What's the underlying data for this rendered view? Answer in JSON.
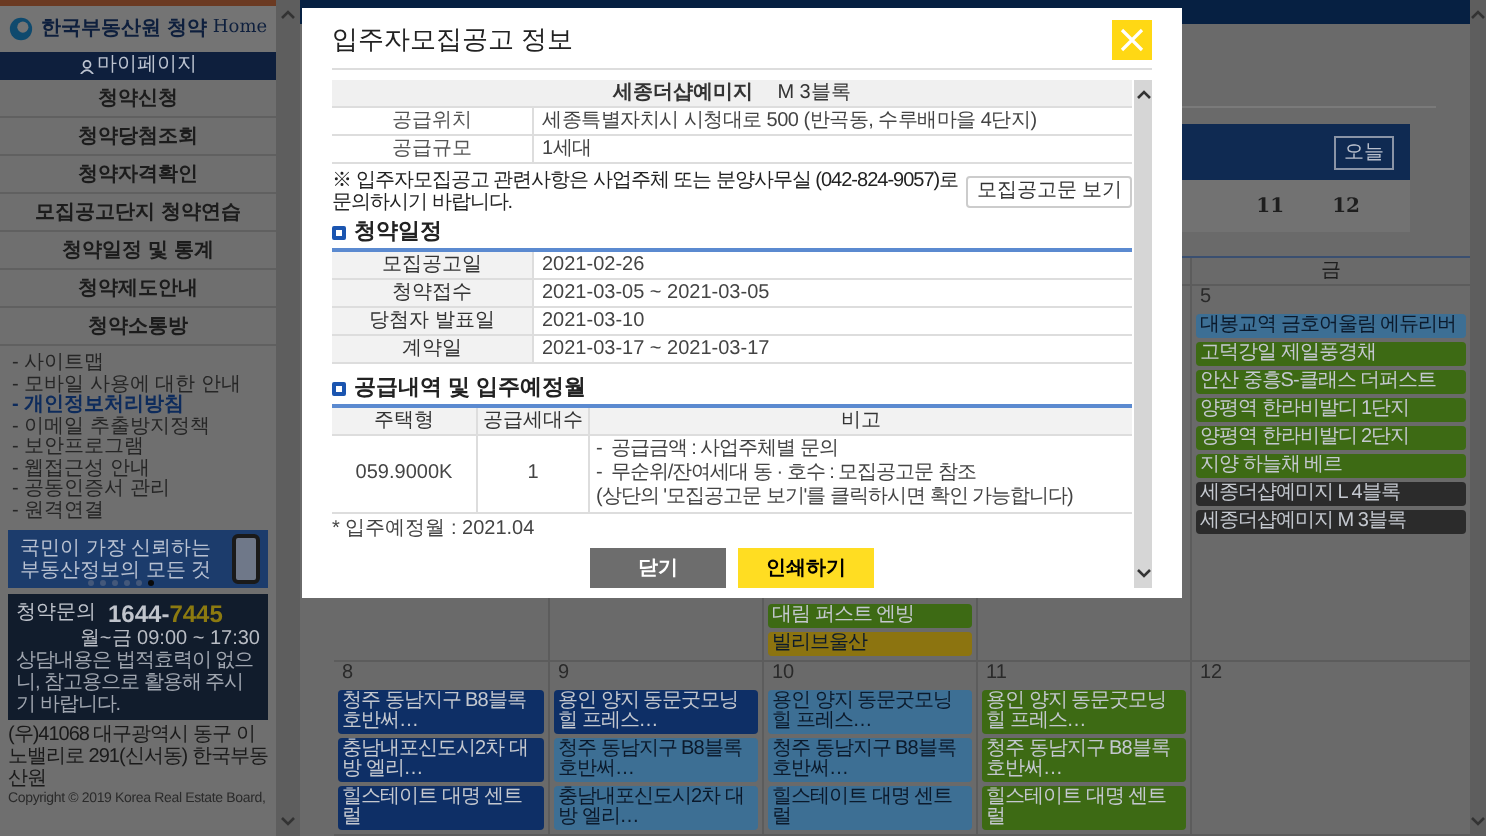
{
  "sidebar": {
    "brand": "한국부동산원",
    "service": "청약",
    "service_suffix": "Home",
    "mypage": "마이페이지",
    "menu": [
      "청약신청",
      "청약당첨조회",
      "청약자격확인",
      "모집공고단지 청약연습",
      "청약일정 및 통계",
      "청약제도안내",
      "청약소통방"
    ],
    "links": [
      {
        "label": "- 사이트맵",
        "highlighted": false
      },
      {
        "label": "- 모바일 사용에 대한 안내",
        "highlighted": false
      },
      {
        "label": "- 개인정보처리방침",
        "highlighted": true
      },
      {
        "label": "- 이메일 추출방지정책",
        "highlighted": false
      },
      {
        "label": "- 보안프로그램",
        "highlighted": false
      },
      {
        "label": "- 웹접근성 안내",
        "highlighted": false
      },
      {
        "label": "- 공동인증서 관리",
        "highlighted": false
      },
      {
        "label": "- 원격연결",
        "highlighted": false
      }
    ],
    "banner": {
      "lines": [
        "국민이 가장 신뢰하는",
        "부동산정보의 모든 것"
      ],
      "dots": [
        {
          "selected": false
        },
        {
          "selected": false
        },
        {
          "selected": false
        },
        {
          "selected": false
        },
        {
          "selected": false
        },
        {
          "selected": true
        }
      ]
    },
    "inquiry": {
      "label": "청약문의",
      "phone_prefix": "1644-",
      "phone_suffix": "7445",
      "hours": "월~금 09:00 ~ 17:30",
      "notice": "상담내용은 법적효력이 없으니, 참고용으로 활용해 주시기 바랍니다."
    },
    "address": "(우)41068 대구광역시 동구 이노밸리로 291(신서동) 한국부동산원",
    "copyright": "Copyright © 2019 Korea Real Estate Board,"
  },
  "calendar": {
    "today_button": "오늘",
    "strip_days": [
      "11",
      "12"
    ],
    "weekday_header": "금",
    "weeks": [
      {
        "cells": [
          {},
          {},
          {
            "events": [
              {
                "title": "대림 퍼스트 엔빙",
                "color": "#3d6a14"
              },
              {
                "title": "빌리브울산",
                "color": "#8c7410"
              }
            ]
          },
          {},
          {
            "date": "5",
            "events": [
              {
                "title": "대봉교역 금호어울림 에듀리버",
                "color": "#3d6f94"
              },
              {
                "title": "고덕강일 제일풍경채",
                "color": "#3d6a14"
              },
              {
                "title": "안산 중흥S-클래스 더퍼스트",
                "color": "#3d6a14"
              },
              {
                "title": "양평역 한라비발디 1단지",
                "color": "#3d6a14"
              },
              {
                "title": "양평역 한라비발디 2단지",
                "color": "#3d6a14"
              },
              {
                "title": "지양 하늘채 베르",
                "color": "#3d6a14"
              },
              {
                "title": "세종더샵예미지 L 4블록",
                "color": "#2b2b2b"
              },
              {
                "title": "세종더샵예미지 M 3블록",
                "color": "#2b2b2b"
              }
            ]
          }
        ]
      },
      {
        "cells": [
          {
            "date": "8",
            "events": [
              {
                "title": "청주 동남지구 B8블록 호반써…",
                "color": "#0e2f66"
              },
              {
                "title": "충남내포신도시2차 대방 엘리…",
                "color": "#0e2f66"
              },
              {
                "title": "힐스테이트 대명 센트럴",
                "color": "#0e2f66"
              }
            ]
          },
          {
            "date": "9",
            "events": [
              {
                "title": "용인 양지 동문굿모닝힐 프레스…",
                "color": "#0e2f66"
              },
              {
                "title": "청주 동남지구 B8블록 호반써…",
                "color": "#3d6f94"
              },
              {
                "title": "충남내포신도시2차 대방 엘리…",
                "color": "#3d6f94"
              }
            ]
          },
          {
            "date": "10",
            "events": [
              {
                "title": "용인 양지 동문굿모닝힐 프레스…",
                "color": "#3d6f94"
              },
              {
                "title": "청주 동남지구 B8블록 호반써…",
                "color": "#3d6f94"
              },
              {
                "title": "힐스테이트 대명 센트럴",
                "color": "#3d6f94"
              }
            ]
          },
          {
            "date": "11",
            "events": [
              {
                "title": "용인 양지 동문굿모닝힐 프레스…",
                "color": "#3d6a14"
              },
              {
                "title": "청주 동남지구 B8블록 호반써…",
                "color": "#3d6a14"
              },
              {
                "title": "힐스테이트 대명 센트럴",
                "color": "#3d6a14"
              }
            ]
          },
          {
            "date": "12"
          }
        ]
      }
    ]
  },
  "modal": {
    "title": "입주자모집공고 정보",
    "complex": {
      "name": "세종더샵예미지",
      "block": "M 3블록"
    },
    "info_rows": [
      {
        "label": "공급위치",
        "value": "세종특별자치시 시청대로 500 (반곡동, 수루배마을 4단지)"
      },
      {
        "label": "공급규모",
        "value": "1세대"
      }
    ],
    "notice": "※ 입주자모집공고 관련사항은 사업주체 또는 분양사무실 (042-824-9057)로 문의하시기 바랍니다.",
    "notice_button": "모집공고문 보기",
    "schedule": {
      "heading": "청약일정",
      "rows": [
        {
          "label": "모집공고일",
          "value": "2021-02-26"
        },
        {
          "label": "청약접수",
          "value": "2021-03-05 ~ 2021-03-05"
        },
        {
          "label": "당첨자 발표일",
          "value": "2021-03-10"
        },
        {
          "label": "계약일",
          "value": "2021-03-17 ~ 2021-03-17"
        }
      ]
    },
    "supply": {
      "heading": "공급내역 및 입주예정월",
      "columns": [
        "주택형",
        "공급세대수",
        "비고"
      ],
      "rows": [
        {
          "type": "059.9000K",
          "units": "1",
          "remarks": [
            "-  공급금액 : 사업주체별 문의",
            "-  무순위/잔여세대 동 · 호수 : 모집공고문 참조",
            "(상단의 '모집공고문 보기'를 클릭하시면 확인 가능합니다)"
          ]
        }
      ],
      "move_in": "* 입주예정월 : 2021.04"
    },
    "buttons": [
      {
        "label": "닫기",
        "kind": "secondary"
      },
      {
        "label": "인쇄하기",
        "kind": "primary"
      }
    ]
  }
}
